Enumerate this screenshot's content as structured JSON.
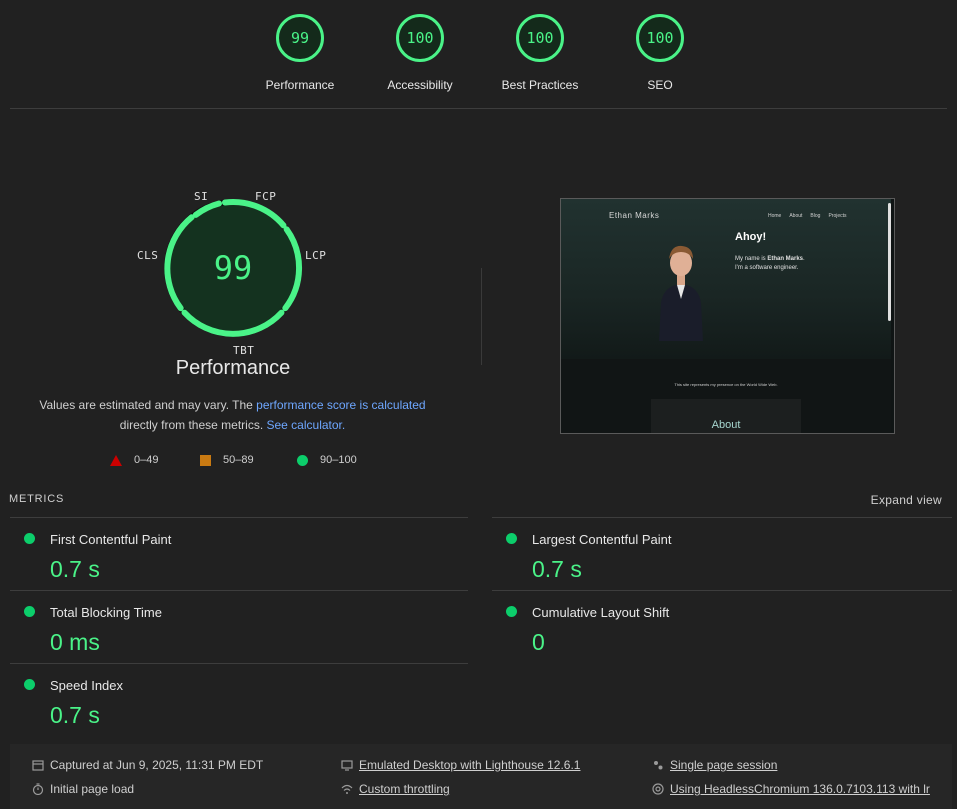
{
  "top_scores": [
    {
      "score": "99",
      "label": "Performance"
    },
    {
      "score": "100",
      "label": "Accessibility"
    },
    {
      "score": "100",
      "label": "Best Practices"
    },
    {
      "score": "100",
      "label": "SEO"
    }
  ],
  "gauge": {
    "score": "99",
    "title": "Performance",
    "labels": {
      "si": "SI",
      "fcp": "FCP",
      "lcp": "LCP",
      "tbt": "TBT",
      "cls": "CLS"
    }
  },
  "note": {
    "text1": "Values are estimated and may vary. The ",
    "link1": "performance score is calculated",
    "text2": "directly from these metrics.",
    "link2": "See calculator."
  },
  "legend": {
    "bad": "0–49",
    "average": "50–89",
    "good": "90–100"
  },
  "thumbnail": {
    "brand": "Ethan Marks",
    "nav": [
      "Home",
      "About",
      "Blog",
      "Projects"
    ],
    "heading": "Ahoy!",
    "intro_pre": "My name is ",
    "intro_name": "Ethan Marks",
    "intro_post": ".",
    "intro_line2": "I'm a software engineer.",
    "tagline": "This site represents my presence on the World Wide Web.",
    "about": "About"
  },
  "metrics": {
    "title": "METRICS",
    "expand": "Expand view",
    "items": [
      {
        "name": "First Contentful Paint",
        "value": "0.7 s"
      },
      {
        "name": "Largest Contentful Paint",
        "value": "0.7 s"
      },
      {
        "name": "Total Blocking Time",
        "value": "0 ms"
      },
      {
        "name": "Cumulative Layout Shift",
        "value": "0"
      },
      {
        "name": "Speed Index",
        "value": "0.7 s"
      }
    ]
  },
  "footer": {
    "captured": "Captured at Jun 9, 2025, 11:31 PM EDT",
    "load": "Initial page load",
    "emulated": "Emulated Desktop with Lighthouse 12.6.1",
    "throttling": "Custom throttling",
    "session": "Single page session",
    "browser": "Using HeadlessChromium 136.0.7103.113 with lr"
  },
  "colors": {
    "good": "#0cce6b",
    "good_text": "#4af388",
    "average": "#c97a12",
    "bad": "#cc0000",
    "link": "#6ea7ff"
  }
}
